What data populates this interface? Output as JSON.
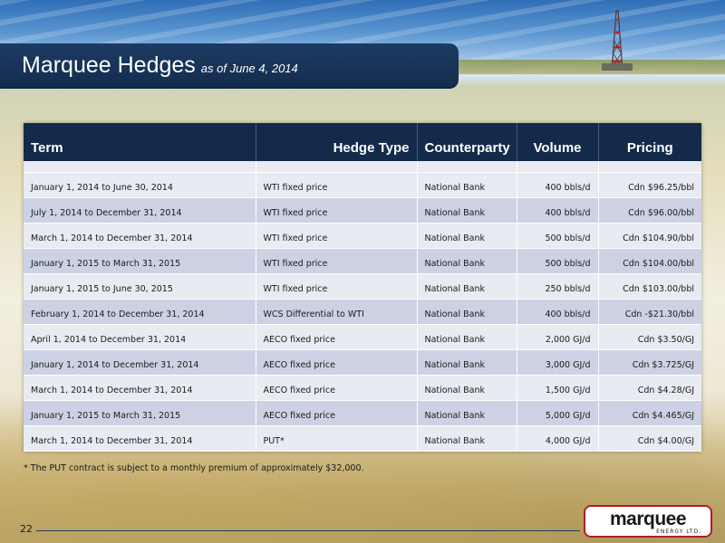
{
  "title": {
    "main": "Marquee Hedges",
    "sub": "as of June 4, 2014"
  },
  "table": {
    "headers": {
      "term": "Term",
      "hedge_type": "Hedge Type",
      "counterparty": "Counterparty",
      "volume": "Volume",
      "pricing": "Pricing"
    },
    "rows": [
      {
        "term": "January 1, 2014 to June 30, 2014",
        "hedge_type": "WTI fixed price",
        "counterparty": "National Bank",
        "volume": "400 bbls/d",
        "pricing": "Cdn $96.25/bbl"
      },
      {
        "term": "July 1, 2014 to December 31, 2014",
        "hedge_type": "WTI fixed price",
        "counterparty": "National Bank",
        "volume": "400 bbls/d",
        "pricing": "Cdn $96.00/bbl"
      },
      {
        "term": "March 1, 2014 to December 31, 2014",
        "hedge_type": "WTI fixed price",
        "counterparty": "National Bank",
        "volume": "500 bbls/d",
        "pricing": "Cdn $104.90/bbl"
      },
      {
        "term": "January 1, 2015 to March 31, 2015",
        "hedge_type": "WTI fixed price",
        "counterparty": "National Bank",
        "volume": "500 bbls/d",
        "pricing": "Cdn $104.00/bbl"
      },
      {
        "term": "January 1, 2015 to June 30, 2015",
        "hedge_type": "WTI fixed price",
        "counterparty": "National Bank",
        "volume": "250 bbls/d",
        "pricing": "Cdn $103.00/bbl"
      },
      {
        "term": "February 1, 2014 to December 31, 2014",
        "hedge_type": "WCS Differential to WTI",
        "counterparty": "National Bank",
        "volume": "400 bbls/d",
        "pricing": "Cdn -$21.30/bbl"
      },
      {
        "term": "April 1, 2014 to December 31, 2014",
        "hedge_type": "AECO fixed price",
        "counterparty": "National Bank",
        "volume": "2,000 GJ/d",
        "pricing": "Cdn $3.50/GJ"
      },
      {
        "term": "January 1, 2014 to December 31, 2014",
        "hedge_type": "AECO fixed price",
        "counterparty": "National Bank",
        "volume": "3,000 GJ/d",
        "pricing": "Cdn $3.725/GJ"
      },
      {
        "term": "March 1, 2014 to December 31, 2014",
        "hedge_type": "AECO fixed price",
        "counterparty": "National Bank",
        "volume": "1,500 GJ/d",
        "pricing": "Cdn $4.28/GJ"
      },
      {
        "term": "January 1, 2015 to March 31, 2015",
        "hedge_type": "AECO fixed price",
        "counterparty": "National Bank",
        "volume": "5,000 GJ/d",
        "pricing": "Cdn $4.465/GJ"
      },
      {
        "term": "March 1, 2014 to December 31, 2014",
        "hedge_type": "PUT*",
        "counterparty": "National Bank",
        "volume": "4,000 GJ/d",
        "pricing": "Cdn $4.00/GJ"
      }
    ]
  },
  "footnote": "* The PUT contract is subject to a monthly premium of approximately $32,000.",
  "page_number": "22",
  "logo": {
    "name": "marquee",
    "subtitle": "ENERGY LTD."
  },
  "colors": {
    "title_bar": "#1c3b63",
    "header_bg": "#132a4b",
    "row_dark": "#ccd2e4",
    "row_light": "#e9ebf2",
    "logo_border": "#b01c28"
  }
}
